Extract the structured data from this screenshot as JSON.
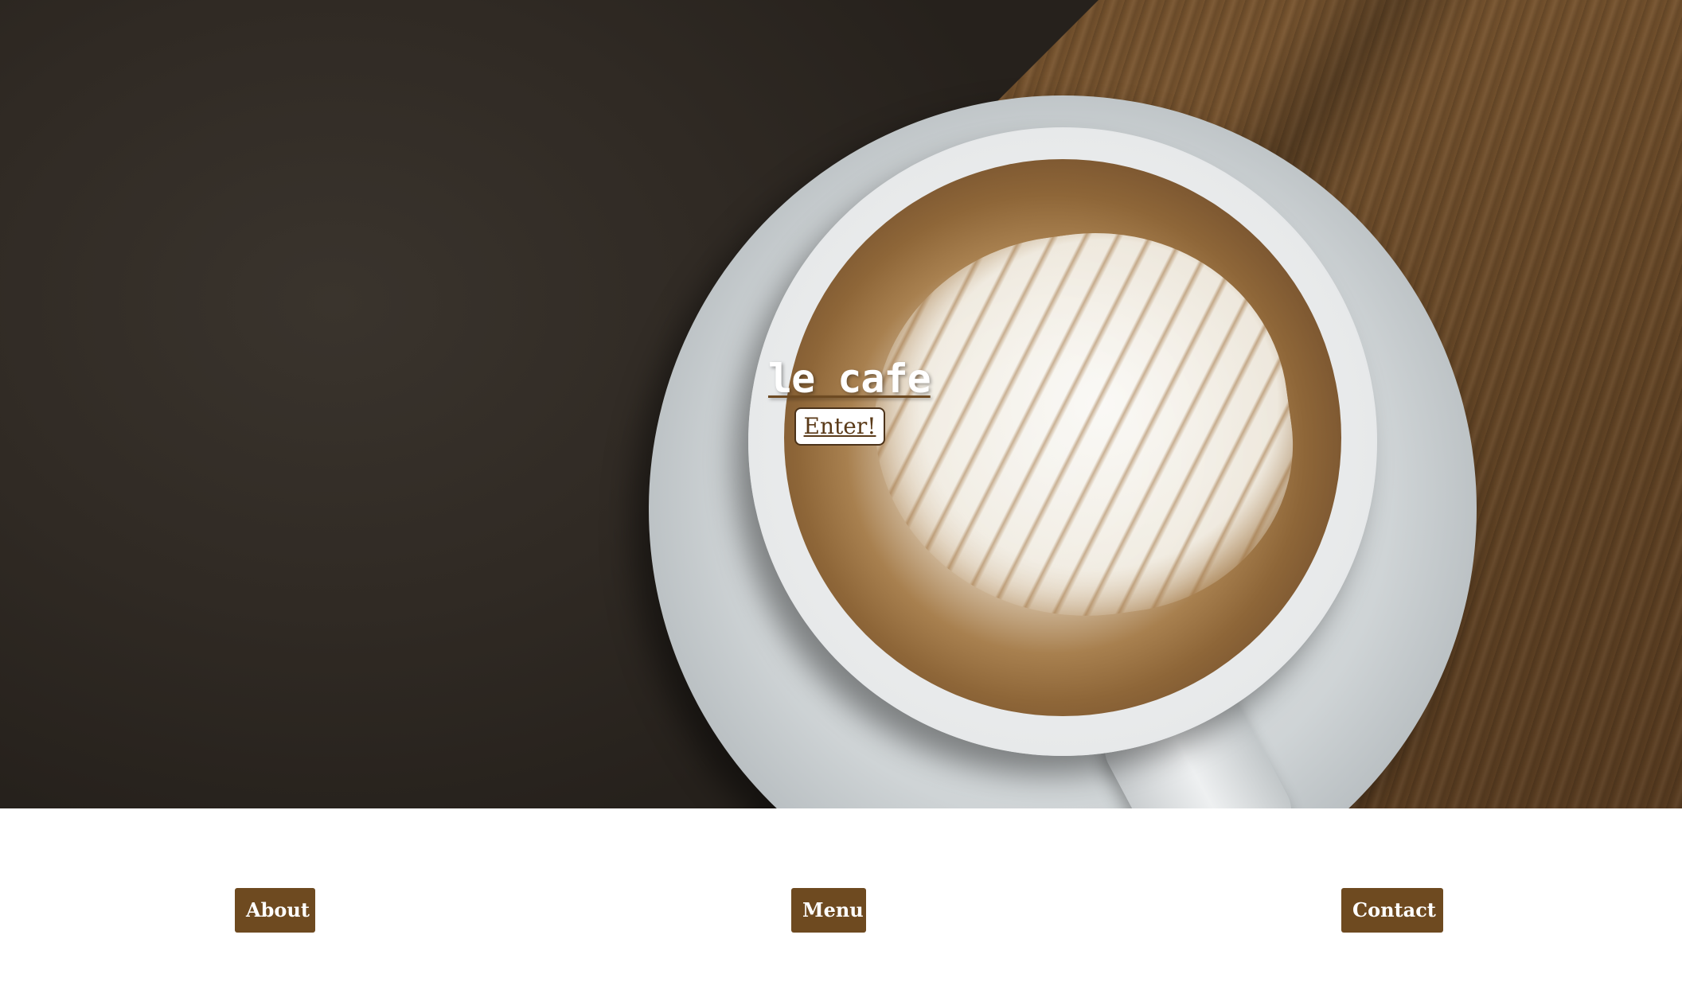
{
  "hero": {
    "title": "le cafe",
    "enter_label": "Enter!"
  },
  "nav": {
    "items": [
      {
        "label": "About"
      },
      {
        "label": "Menu"
      },
      {
        "label": "Contact"
      }
    ]
  },
  "colors": {
    "accent": "#6e4a20",
    "white": "#ffffff"
  }
}
